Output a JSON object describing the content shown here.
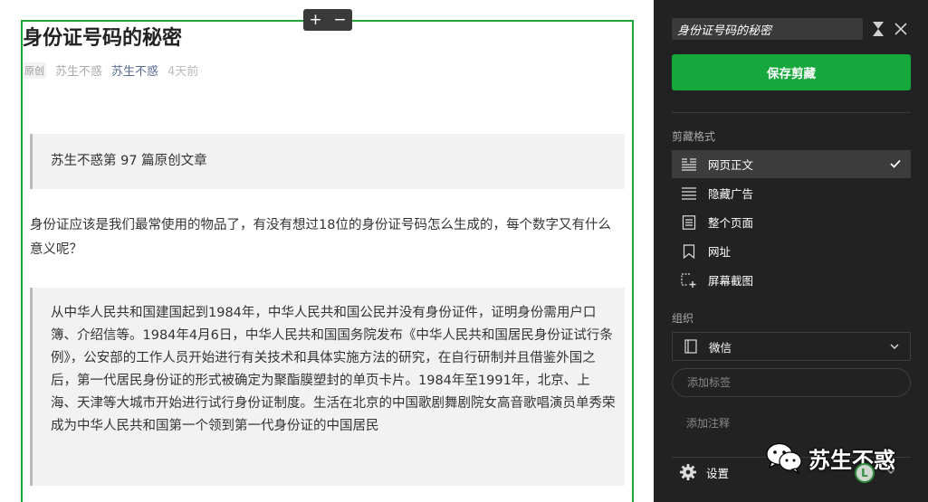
{
  "article": {
    "title": "身份证号码的秘密",
    "badge": "原创",
    "author": "苏生不惑",
    "account": "苏生不惑",
    "time": "4天前",
    "quote1": "苏生不惑第 97 篇原创文章",
    "paragraph": "身份证应该是我们最常使用的物品了，有没有想过18位的身份证号码怎么生成的，每个数字又有什么意义呢？",
    "quote2": "从中华人民共和国建国起到1984年，中华人民共和国公民并没有身份证件，证明身份需用户口簿、介绍信等。1984年4月6日，中华人民共和国国务院发布《中华人民共和国居民身份证试行条例》，公安部的工作人员开始进行有关技术和具体实施方法的研究，在自行研制并且借鉴外国之后，第一代居民身份证的形式被确定为聚酯膜塑封的单页卡片。1984年至1991年，北京、上海、天津等大城市开始进行试行身份证制度。生活在北京的中国歌剧舞剧院女高音歌唱演员单秀荣成为中华人民共和国第一个领到第一代身份证的中国居民"
  },
  "zoom": {
    "plus": "+",
    "minus": "−"
  },
  "watermark": {
    "text": "苏生不惑",
    "icon": "wechat-icon"
  },
  "panel": {
    "title_value": "身份证号码的秘密",
    "save_label": "保存剪藏",
    "format_label": "剪藏格式",
    "formats": [
      {
        "label": "网页正文",
        "icon": "article-icon",
        "active": true
      },
      {
        "label": "隐藏广告",
        "icon": "hide-ads-icon",
        "active": false
      },
      {
        "label": "整个页面",
        "icon": "full-page-icon",
        "active": false
      },
      {
        "label": "网址",
        "icon": "bookmark-icon",
        "active": false
      },
      {
        "label": "屏幕截图",
        "icon": "screenshot-icon",
        "active": false
      }
    ],
    "organize_label": "组织",
    "notebook": "微信",
    "tag_placeholder": "添加标签",
    "note_placeholder": "添加注释",
    "settings_label": "设置",
    "account_initial": "L"
  },
  "colors": {
    "frame_green": "#21a33b",
    "save_green": "#16a83d",
    "panel_bg": "#222222",
    "link_blue": "#576b95"
  }
}
